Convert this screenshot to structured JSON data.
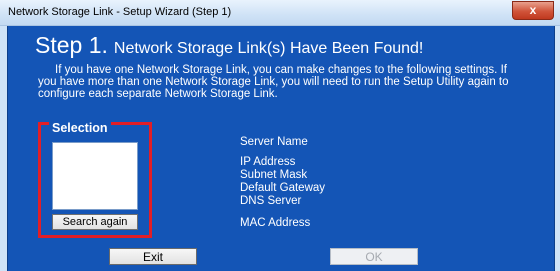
{
  "window": {
    "title": "Network Storage Link - Setup Wizard (Step 1)",
    "close_label": "x"
  },
  "header": {
    "step_label": "Step 1.",
    "step_title": "Network Storage Link(s) Have Been Found!"
  },
  "intro": {
    "text": "If you have one Network Storage Link, you can make changes to the following settings. If you have more than one Network Storage Link, you will need to run the Setup Utility again to configure each separate Network Storage Link."
  },
  "selection": {
    "legend": "Selection",
    "search_button": "Search again"
  },
  "info_labels": {
    "server_name": "Server Name",
    "ip_address": "IP Address",
    "subnet_mask": "Subnet Mask",
    "default_gateway": "Default Gateway",
    "dns_server": "DNS Server",
    "mac_address": "MAC Address"
  },
  "footer": {
    "exit_label": "Exit",
    "ok_label": "OK"
  },
  "colors": {
    "dialog_blue": "#1455b6",
    "highlight_red": "#e21e26"
  }
}
